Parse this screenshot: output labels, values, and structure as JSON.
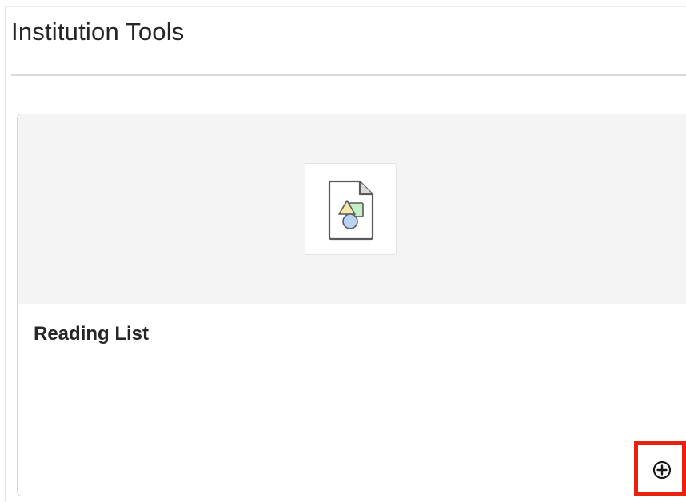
{
  "section": {
    "title": "Institution Tools"
  },
  "tool_card": {
    "title": "Reading List",
    "icon": "document-shapes-icon",
    "add_action_icon": "add-circle-icon"
  },
  "colors": {
    "highlight": "#e8210f",
    "banner_background": "#f4f4f4",
    "text": "#262626"
  }
}
